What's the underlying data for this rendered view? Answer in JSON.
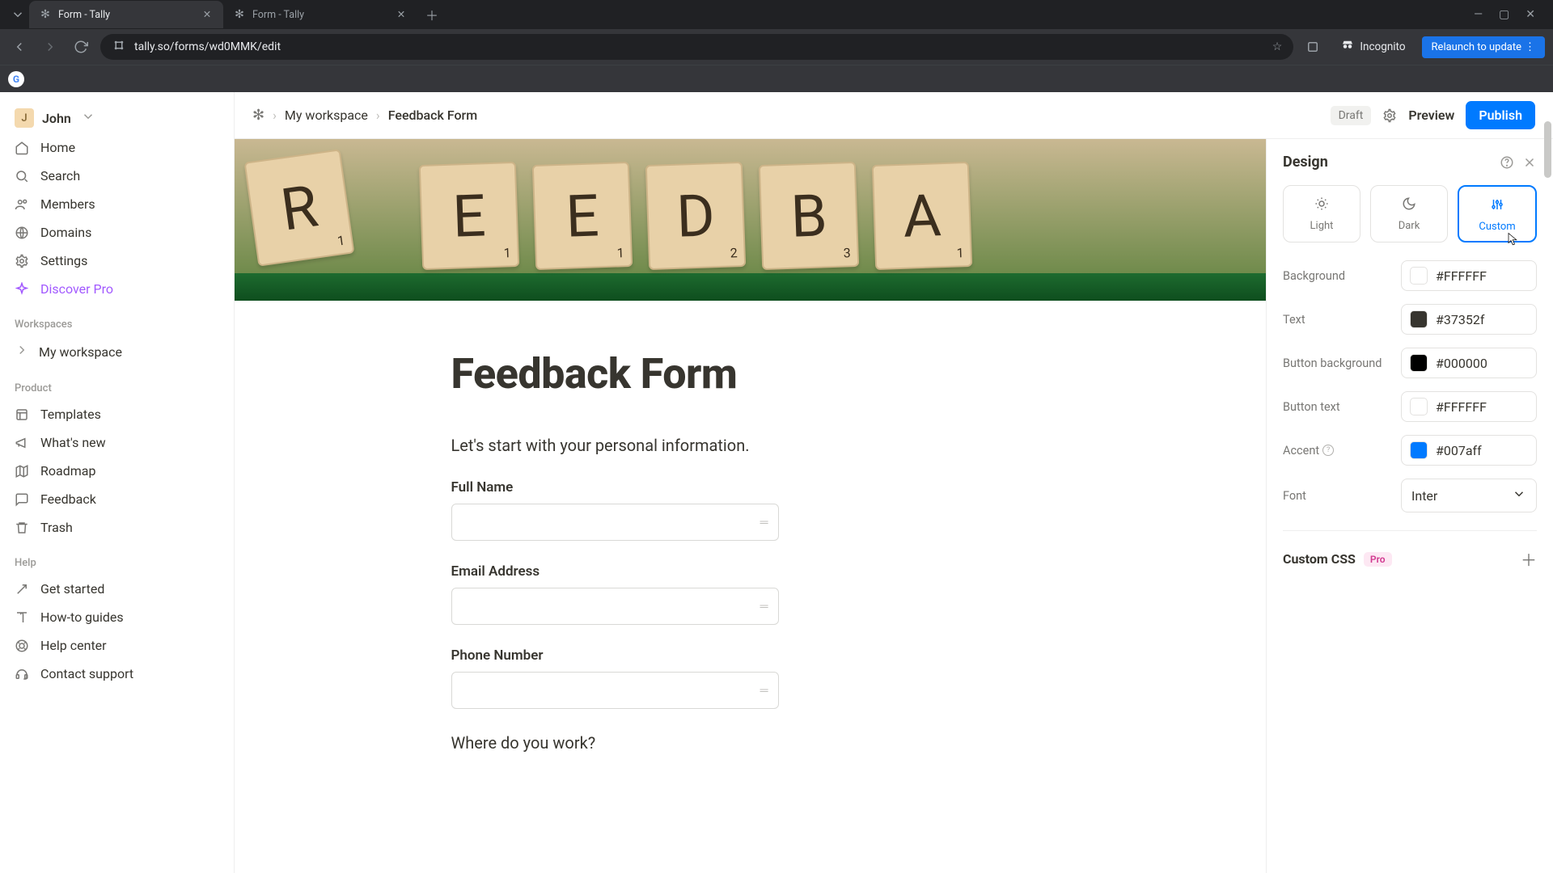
{
  "browser": {
    "tabs": [
      {
        "title": "Form - Tally",
        "active": true
      },
      {
        "title": "Form - Tally",
        "active": false
      }
    ],
    "url": "tally.so/forms/wd0MMK/edit",
    "incognito_label": "Incognito",
    "relaunch_label": "Relaunch to update"
  },
  "sidebar": {
    "user_initial": "J",
    "user_name": "John",
    "nav": [
      {
        "icon": "home-icon",
        "label": "Home"
      },
      {
        "icon": "search-icon",
        "label": "Search"
      },
      {
        "icon": "members-icon",
        "label": "Members"
      },
      {
        "icon": "globe-icon",
        "label": "Domains"
      },
      {
        "icon": "gear-icon",
        "label": "Settings"
      },
      {
        "icon": "sparkle-icon",
        "label": "Discover Pro",
        "pro": true
      }
    ],
    "workspaces_heading": "Workspaces",
    "workspace_name": "My workspace",
    "product_heading": "Product",
    "product": [
      {
        "icon": "templates-icon",
        "label": "Templates"
      },
      {
        "icon": "megaphone-icon",
        "label": "What's new"
      },
      {
        "icon": "map-icon",
        "label": "Roadmap"
      },
      {
        "icon": "chat-icon",
        "label": "Feedback"
      },
      {
        "icon": "trash-icon",
        "label": "Trash"
      }
    ],
    "help_heading": "Help",
    "help": [
      {
        "icon": "compass-icon",
        "label": "Get started"
      },
      {
        "icon": "book-icon",
        "label": "How-to guides"
      },
      {
        "icon": "lifebuoy-icon",
        "label": "Help center"
      },
      {
        "icon": "headset-icon",
        "label": "Contact support"
      }
    ]
  },
  "topbar": {
    "crumb_workspace": "My workspace",
    "crumb_form": "Feedback Form",
    "draft_label": "Draft",
    "preview_label": "Preview",
    "publish_label": "Publish"
  },
  "form": {
    "title": "Feedback Form",
    "intro": "Let's start with your personal information.",
    "fields": [
      {
        "label": "Full Name"
      },
      {
        "label": "Email Address"
      },
      {
        "label": "Phone Number"
      }
    ],
    "question2": "Where do you work?"
  },
  "design": {
    "title": "Design",
    "themes": {
      "light": "Light",
      "dark": "Dark",
      "custom": "Custom",
      "selected": "custom"
    },
    "rows": {
      "background": {
        "label": "Background",
        "value": "#FFFFFF"
      },
      "text": {
        "label": "Text",
        "value": "#37352f"
      },
      "button_bg": {
        "label": "Button background",
        "value": "#000000"
      },
      "button_text": {
        "label": "Button text",
        "value": "#FFFFFF"
      },
      "accent": {
        "label": "Accent",
        "value": "#007aff"
      }
    },
    "font_label": "Font",
    "font_value": "Inter",
    "custom_css_label": "Custom CSS",
    "pro_badge": "Pro"
  },
  "cover_letters": [
    "R",
    "E",
    "E",
    "D",
    "B",
    "A"
  ]
}
